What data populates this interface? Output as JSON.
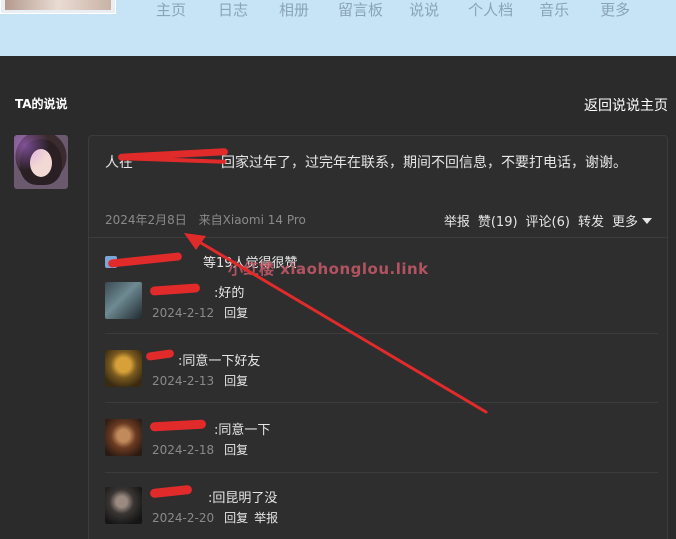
{
  "nav": {
    "items": [
      "主页",
      "日志",
      "相册",
      "留言板",
      "说说",
      "个人档",
      "音乐",
      "更多"
    ]
  },
  "section": {
    "title": "TA的说说",
    "back_link": "返回说说主页"
  },
  "post": {
    "author_visible": "人在",
    "author_tail": "",
    "content": "回家过年了，过完年在联系，期间不回信息，不要打电话，谢谢。",
    "date": "2024年2月8日",
    "source": "来自Xiaomi 14 Pro"
  },
  "actions": {
    "report": "举报",
    "like": "赞(19)",
    "comment": "评论(6)",
    "forward": "转发",
    "more": "更多"
  },
  "likes": {
    "text": "等19人觉得很赞"
  },
  "watermark": "小红楼 xiaohonglou.link",
  "comments": [
    {
      "text": ":好的",
      "date": "2024-2-12",
      "reply": "回复",
      "report": ""
    },
    {
      "text": ":同意一下好友",
      "date": "2024-2-13",
      "reply": "回复",
      "report": ""
    },
    {
      "text": ":同意一下",
      "date": "2024-2-18",
      "reply": "回复",
      "report": ""
    },
    {
      "text": ":回昆明了没",
      "date": "2024-2-20",
      "reply": "回复",
      "report": "举报"
    }
  ],
  "colors": {
    "topbar": "#c7e4f7",
    "background": "#2b2b2b",
    "annotation_red": "#e12b2b"
  }
}
